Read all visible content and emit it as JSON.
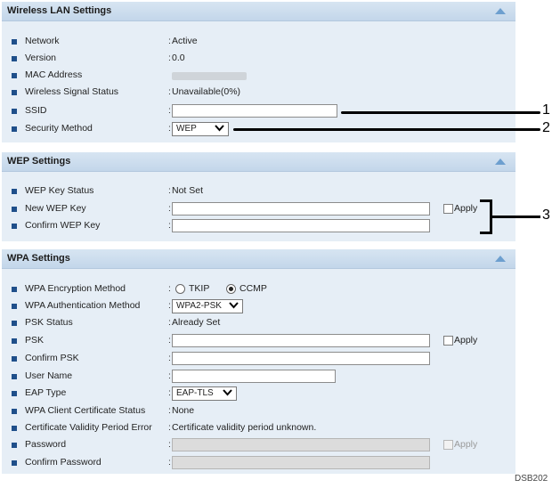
{
  "wireless": {
    "title": "Wireless LAN Settings",
    "network": {
      "label": "Network",
      "value": "Active"
    },
    "version": {
      "label": "Version",
      "value": "0.0"
    },
    "mac": {
      "label": "MAC Address"
    },
    "signal": {
      "label": "Wireless Signal Status",
      "value": "Unavailable(0%)"
    },
    "ssid": {
      "label": "SSID",
      "value": ""
    },
    "security": {
      "label": "Security Method",
      "value": "WEP"
    }
  },
  "wep": {
    "title": "WEP Settings",
    "key_status": {
      "label": "WEP Key Status",
      "value": "Not Set"
    },
    "new_key": {
      "label": "New WEP Key",
      "value": ""
    },
    "confirm_key": {
      "label": "Confirm WEP Key",
      "value": ""
    },
    "apply_label": "Apply"
  },
  "wpa": {
    "title": "WPA Settings",
    "encryption": {
      "label": "WPA Encryption Method",
      "options": [
        "TKIP",
        "CCMP"
      ],
      "selected": "CCMP"
    },
    "auth": {
      "label": "WPA Authentication Method",
      "value": "WPA2-PSK"
    },
    "psk_status": {
      "label": "PSK Status",
      "value": "Already Set"
    },
    "psk": {
      "label": "PSK",
      "value": ""
    },
    "confirm_psk": {
      "label": "Confirm PSK",
      "value": ""
    },
    "user_name": {
      "label": "User Name",
      "value": ""
    },
    "eap_type": {
      "label": "EAP Type",
      "value": "EAP-TLS"
    },
    "client_cert": {
      "label": "WPA Client Certificate Status",
      "value": "None"
    },
    "cert_error": {
      "label": "Certificate Validity Period Error",
      "value": "Certificate validity period unknown."
    },
    "password": {
      "label": "Password",
      "value": ""
    },
    "confirm_password": {
      "label": "Confirm Password",
      "value": ""
    },
    "apply_label": "Apply"
  },
  "callouts": [
    "1",
    "2",
    "3"
  ],
  "doc_code": "DSB202",
  "colors": {
    "header": "#c9dbed",
    "panel": "#e6eef6",
    "bullet": "#1f4f8a",
    "triangle": "#6d9fcf"
  },
  "icons": {
    "collapse": "triangle-up",
    "dropdown": "chevron-down",
    "bullet": "square-bullet"
  }
}
